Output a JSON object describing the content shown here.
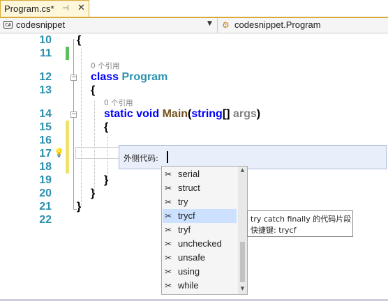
{
  "tab": {
    "title": "Program.cs*",
    "pin_icon": "pin-icon",
    "close_icon": "close-icon"
  },
  "navbar": {
    "project": "codesnippet",
    "project_icon": "csharp-project-icon",
    "member": "codesnippet.Program",
    "member_icon": "class-icon"
  },
  "editor": {
    "line_numbers": [
      "10",
      "11",
      "12",
      "13",
      "14",
      "15",
      "16",
      "17",
      "18",
      "19",
      "20",
      "21",
      "22"
    ],
    "reference_label_1": "0 个引用",
    "reference_label_2": "0 个引用",
    "code": {
      "open_brace_ns": "{",
      "class_kw": "class",
      "class_name": "Program",
      "open_brace_class": "{",
      "static_kw": "static",
      "void_kw": "void",
      "method_name": "Main",
      "open_paren": "(",
      "string_kw": "string",
      "array_suffix": "[]",
      "param_name": "args",
      "close_paren": ")",
      "open_brace_method": "{",
      "close_brace_method": "}",
      "close_brace_class": "}",
      "close_brace_ns": "}"
    },
    "colors": {
      "keyword": "#0000ff",
      "type": "#2b91af",
      "method": "#74531f",
      "parameter": "#808080",
      "line_number": "#2b91af",
      "saved_change": "#5cc05c",
      "unsaved_change": "#efe26b"
    }
  },
  "surround_with": {
    "label": "外侧代码:",
    "value": ""
  },
  "completion_list": {
    "items": [
      "serial",
      "struct",
      "try",
      "trycf",
      "tryf",
      "unchecked",
      "unsafe",
      "using",
      "while"
    ],
    "selected": "trycf",
    "item_icon": "code-snippet-icon"
  },
  "tooltip": {
    "description": "try catch finally 的代码片段",
    "shortcut": "快捷键: trycf"
  }
}
